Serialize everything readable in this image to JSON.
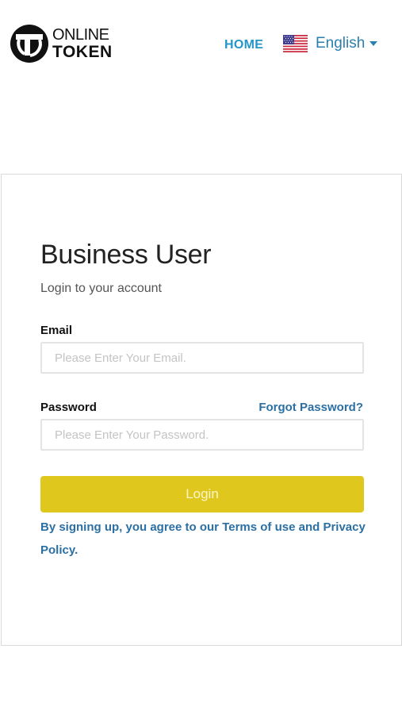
{
  "header": {
    "logo_line1": "ONLINE",
    "logo_line2": "TOKEN",
    "home_label": "HOME",
    "language": "English",
    "flag_icon": "us-flag-icon"
  },
  "login": {
    "title": "Business User",
    "subtitle": "Login to your account",
    "email_label": "Email",
    "email_placeholder": "Please Enter Your Email.",
    "email_value": "",
    "password_label": "Password",
    "forgot_label": "Forgot Password?",
    "password_placeholder": "Please Enter Your Password.",
    "password_value": "",
    "login_label": "Login",
    "terms_prefix": "By signing up, you agree to our ",
    "terms_link": "Terms of use",
    "terms_and": " and ",
    "privacy_link": "Privacy Policy",
    "terms_suffix": "."
  },
  "colors": {
    "link": "#2b6fa3",
    "home": "#2496c9",
    "login_button": "#dfc71d"
  }
}
